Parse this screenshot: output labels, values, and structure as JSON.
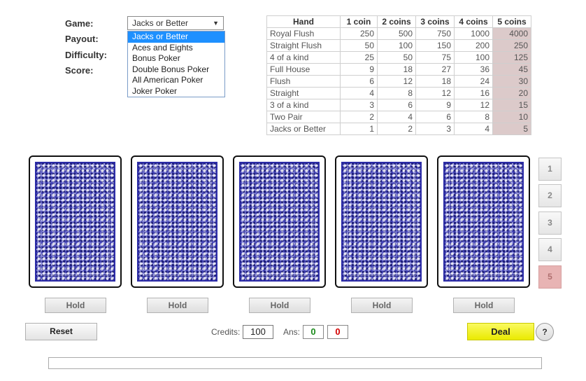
{
  "settings": {
    "game_label": "Game:",
    "payout_label": "Payout:",
    "difficulty_label": "Difficulty:",
    "score_label": "Score:",
    "game_selected": "Jacks or Better",
    "game_options": [
      "Jacks or Better",
      "Aces and Eights",
      "Bonus Poker",
      "Double Bonus Poker",
      "All American Poker",
      "Joker Poker"
    ]
  },
  "payout_table": {
    "headers": [
      "Hand",
      "1 coin",
      "2 coins",
      "3 coins",
      "4 coins",
      "5 coins"
    ],
    "rows": [
      {
        "hand": "Royal Flush",
        "v": [
          "250",
          "500",
          "750",
          "1000",
          "4000"
        ]
      },
      {
        "hand": "Straight Flush",
        "v": [
          "50",
          "100",
          "150",
          "200",
          "250"
        ]
      },
      {
        "hand": "4 of a kind",
        "v": [
          "25",
          "50",
          "75",
          "100",
          "125"
        ]
      },
      {
        "hand": "Full House",
        "v": [
          "9",
          "18",
          "27",
          "36",
          "45"
        ]
      },
      {
        "hand": "Flush",
        "v": [
          "6",
          "12",
          "18",
          "24",
          "30"
        ]
      },
      {
        "hand": "Straight",
        "v": [
          "4",
          "8",
          "12",
          "16",
          "20"
        ]
      },
      {
        "hand": "3 of a kind",
        "v": [
          "3",
          "6",
          "9",
          "12",
          "15"
        ]
      },
      {
        "hand": "Two Pair",
        "v": [
          "2",
          "4",
          "6",
          "8",
          "10"
        ]
      },
      {
        "hand": "Jacks or Better",
        "v": [
          "1",
          "2",
          "3",
          "4",
          "5"
        ]
      }
    ],
    "highlight_color": "#dccaca"
  },
  "hold_label": "Hold",
  "bets": [
    "1",
    "2",
    "3",
    "4",
    "5"
  ],
  "active_bet": "5",
  "controls": {
    "reset_label": "Reset",
    "credits_label": "Credits:",
    "credits_value": "100",
    "ans_label": "Ans:",
    "ans_correct": "0",
    "ans_wrong": "0",
    "deal_label": "Deal",
    "help_label": "?"
  },
  "colors": {
    "deal_button": "#eeee22",
    "card_back": "#6a6ae0",
    "correct": "#1a8a1a",
    "wrong": "#d40000",
    "dropdown_highlight": "#1e90ff"
  },
  "icons": {
    "dropdown_arrow": "dropdown-arrow-icon",
    "card_back": "card-back-pattern"
  }
}
